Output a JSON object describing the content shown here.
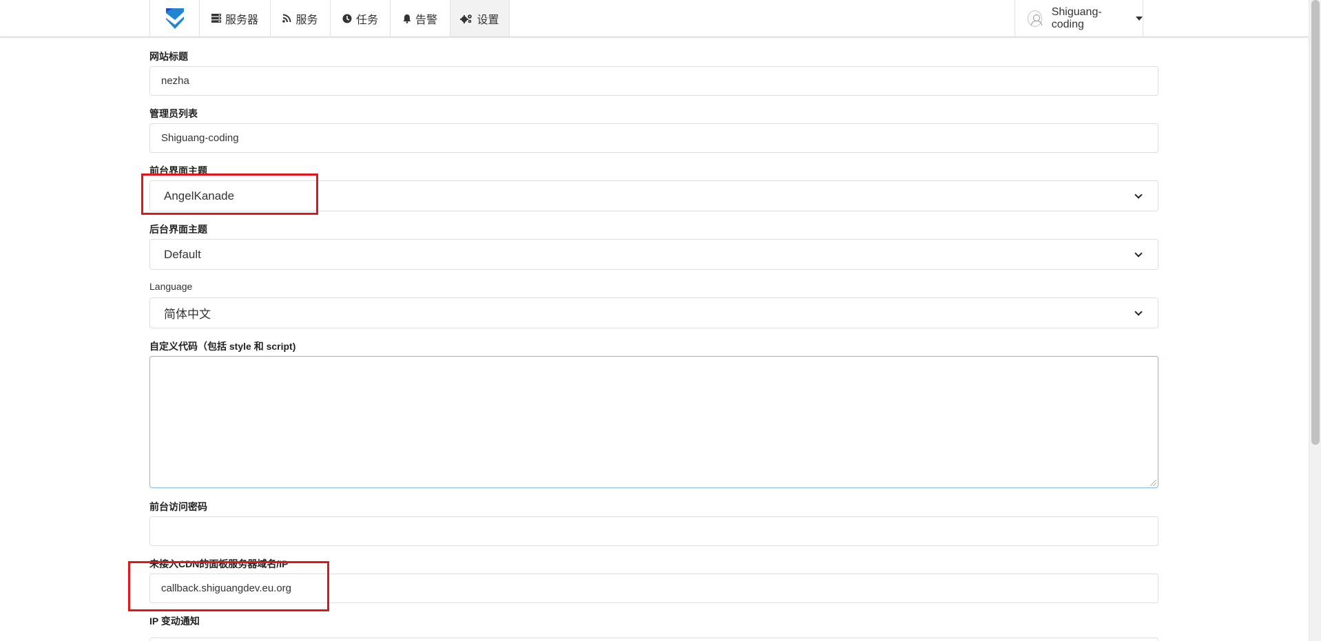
{
  "nav": {
    "items": [
      {
        "label": "服务器",
        "icon": "server-icon"
      },
      {
        "label": "服务",
        "icon": "rss-icon"
      },
      {
        "label": "任务",
        "icon": "clock-icon"
      },
      {
        "label": "告警",
        "icon": "bell-icon"
      },
      {
        "label": "设置",
        "icon": "cogs-icon",
        "active": true
      }
    ],
    "user": {
      "name": "Shiguang-coding"
    }
  },
  "form": {
    "site_title": {
      "label": "网站标题",
      "value": "nezha"
    },
    "admins": {
      "label": "管理员列表",
      "value": "Shiguang-coding"
    },
    "frontend_theme": {
      "label": "前台界面主题",
      "value": "AngelKanade"
    },
    "backend_theme": {
      "label": "后台界面主题",
      "value": "Default"
    },
    "language": {
      "label": "Language",
      "value": "简体中文"
    },
    "custom_code": {
      "label": "自定义代码（包括 style 和 script)",
      "value": ""
    },
    "frontend_password": {
      "label": "前台访问密码",
      "value": ""
    },
    "panel_domain": {
      "label": "未接入CDN的面板服务器域名/IP",
      "value": "callback.shiguangdev.eu.org"
    },
    "ip_change": {
      "label": "IP 变动通知"
    }
  },
  "colors": {
    "logo_blue": "#1f6feb",
    "highlight_red": "#e4141b",
    "focus_border": "#85b7d9"
  }
}
